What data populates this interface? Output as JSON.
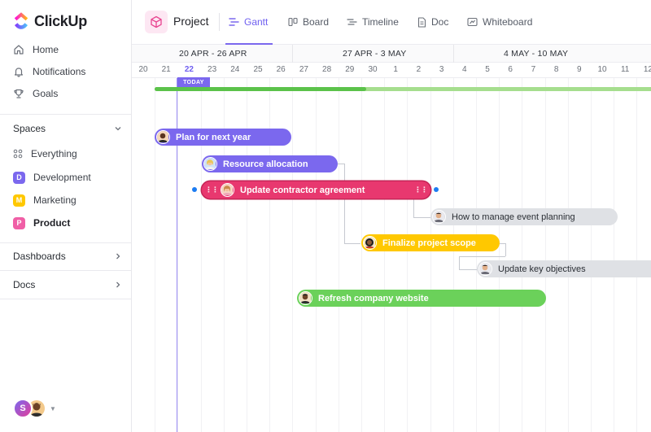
{
  "app": {
    "name": "ClickUp"
  },
  "sidebar": {
    "nav": [
      {
        "label": "Home",
        "icon": "home-icon"
      },
      {
        "label": "Notifications",
        "icon": "bell-icon"
      },
      {
        "label": "Goals",
        "icon": "trophy-icon"
      }
    ],
    "spaces_label": "Spaces",
    "everything_label": "Everything",
    "spaces": [
      {
        "letter": "D",
        "label": "Development",
        "color": "#7b68ee"
      },
      {
        "letter": "M",
        "label": "Marketing",
        "color": "#ffc800"
      },
      {
        "letter": "P",
        "label": "Product",
        "color": "#f05fa6"
      }
    ],
    "dashboards_label": "Dashboards",
    "docs_label": "Docs",
    "user_initial": "S"
  },
  "topbar": {
    "project_title": "Project",
    "tabs": [
      {
        "label": "Gantt",
        "active": true
      },
      {
        "label": "Board",
        "active": false
      },
      {
        "label": "Timeline",
        "active": false
      },
      {
        "label": "Doc",
        "active": false
      },
      {
        "label": "Whiteboard",
        "active": false
      }
    ]
  },
  "gantt": {
    "weeks": [
      "20 APR - 26 APR",
      "27 APR - 3 MAY",
      "4 MAY - 10 MAY"
    ],
    "days": [
      "20",
      "21",
      "22",
      "23",
      "24",
      "25",
      "26",
      "27",
      "28",
      "29",
      "30",
      "1",
      "2",
      "3",
      "4",
      "5",
      "6",
      "7",
      "8",
      "9",
      "10",
      "11",
      "12"
    ],
    "today_day": "22",
    "today_label": "TODAY",
    "progress": 0.42,
    "tasks": [
      {
        "name": "Plan for next year",
        "color": "#7b68ee"
      },
      {
        "name": "Resource allocation",
        "color": "#7b68ee"
      },
      {
        "name": "Update contractor agreement",
        "color": "#e8386f"
      },
      {
        "name": "How to manage event planning",
        "color": "#dfe1e5"
      },
      {
        "name": "Finalize project scope",
        "color": "#ffc800"
      },
      {
        "name": "Update key objectives",
        "color": "#dfe1e5"
      },
      {
        "name": "Refresh company website",
        "color": "#6bd15a"
      }
    ]
  }
}
